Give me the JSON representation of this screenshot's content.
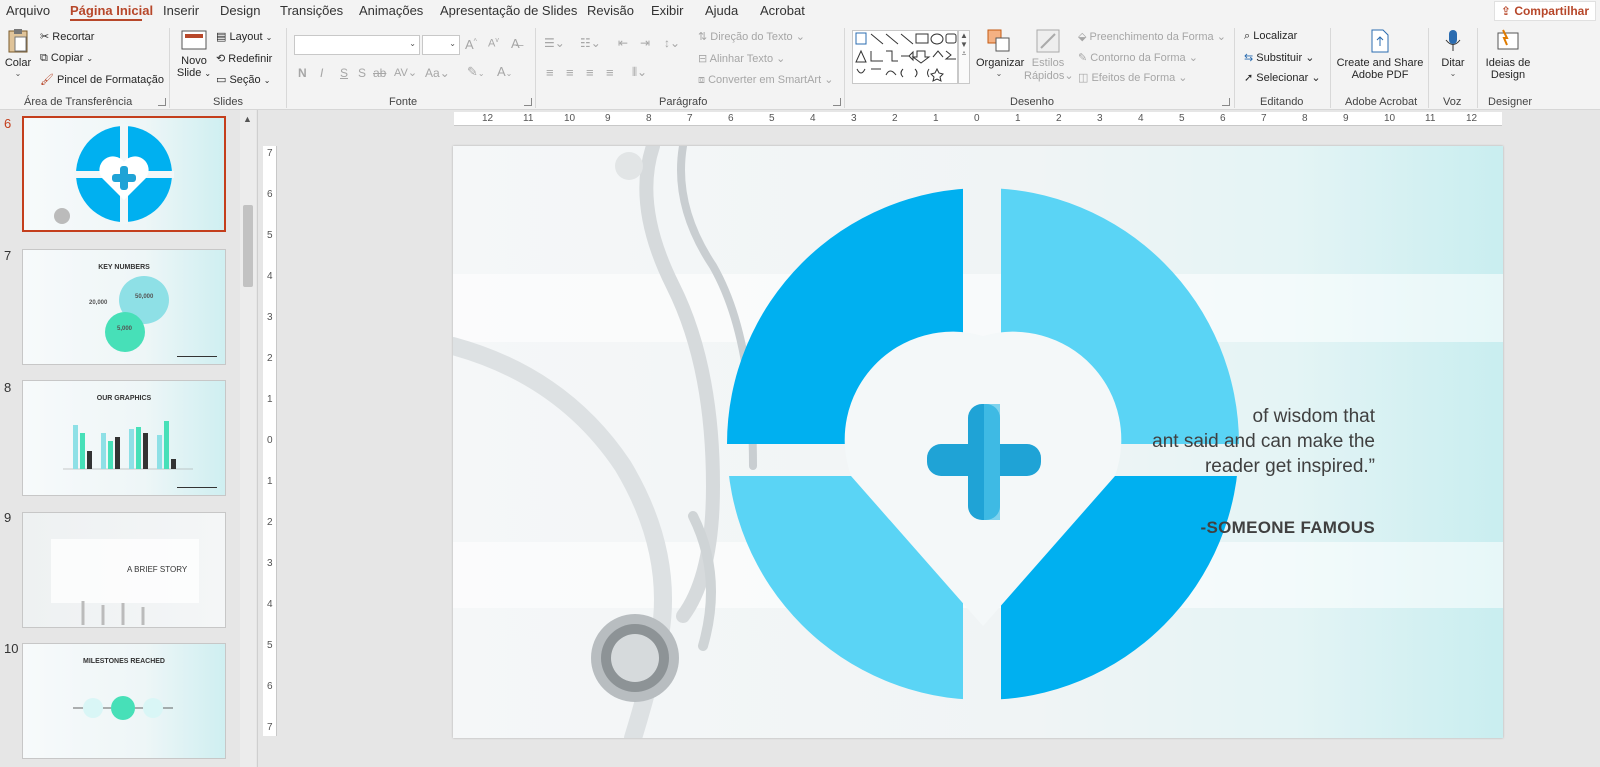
{
  "menu": {
    "tabs": [
      "Arquivo",
      "Página Inicial",
      "Inserir",
      "Design",
      "Transições",
      "Animações",
      "Apresentação de Slides",
      "Revisão",
      "Exibir",
      "Ajuda",
      "Acrobat"
    ],
    "active_tab": "Página Inicial",
    "share_label": "Compartilhar"
  },
  "ribbon": {
    "clipboard": {
      "paste": "Colar",
      "cut": "Recortar",
      "copy": "Copiar",
      "format_painter": "Pincel de Formatação",
      "label": "Área de Transferência"
    },
    "slides": {
      "new_slide_1": "Novo",
      "new_slide_2": "Slide",
      "layout": "Layout",
      "reset": "Redefinir",
      "section": "Seção",
      "label": "Slides"
    },
    "font": {
      "label": "Fonte",
      "bold": "N",
      "italic": "I",
      "underline": "S",
      "shadow": "S",
      "strike": "ab",
      "spacing": "AV",
      "case": "Aa"
    },
    "paragraph": {
      "text_direction": "Direção do Texto",
      "align_text": "Alinhar Texto",
      "smartart": "Converter em SmartArt",
      "label": "Parágrafo"
    },
    "drawing": {
      "arrange": "Organizar",
      "quick_styles_1": "Estilos",
      "quick_styles_2": "Rápidos",
      "shape_fill": "Preenchimento da Forma",
      "shape_outline": "Contorno da Forma",
      "shape_effects": "Efeitos de Forma",
      "label": "Desenho"
    },
    "editing": {
      "find": "Localizar",
      "replace": "Substituir",
      "select": "Selecionar",
      "label": "Editando"
    },
    "acrobat": {
      "line1": "Create and Share",
      "line2": "Adobe PDF",
      "label": "Adobe Acrobat"
    },
    "voice": {
      "dictate": "Ditar",
      "label": "Voz"
    },
    "designer": {
      "line1": "Ideias de",
      "line2": "Design",
      "label": "Designer"
    }
  },
  "thumbnails": [
    {
      "num": "6",
      "title": ""
    },
    {
      "num": "7",
      "title": "KEY NUMBERS",
      "n1": "20,000",
      "n2": "50,000",
      "n3": "5,000"
    },
    {
      "num": "8",
      "title": "OUR GRAPHICS"
    },
    {
      "num": "9",
      "title": "A BRIEF STORY"
    },
    {
      "num": "10",
      "title": "MILESTONES REACHED"
    }
  ],
  "slide": {
    "quote_line1": "of wisdom that",
    "quote_line2": "ant said and can make the",
    "quote_line3": "reader get inspired.”",
    "author": "-SOMEONE FAMOUS",
    "colors": {
      "blue_dark": "#00b0f0",
      "blue_light": "#5ad4f5",
      "cross": "#1fa3d6"
    }
  },
  "rulers": {
    "h": [
      "12",
      "11",
      "10",
      "9",
      "8",
      "7",
      "6",
      "5",
      "4",
      "3",
      "2",
      "1",
      "0",
      "1",
      "2",
      "3",
      "4",
      "5",
      "6",
      "7",
      "8",
      "9",
      "10",
      "11",
      "12"
    ],
    "v": [
      "7",
      "6",
      "5",
      "4",
      "3",
      "2",
      "1",
      "0",
      "1",
      "2",
      "3",
      "4",
      "5",
      "6",
      "7"
    ]
  }
}
